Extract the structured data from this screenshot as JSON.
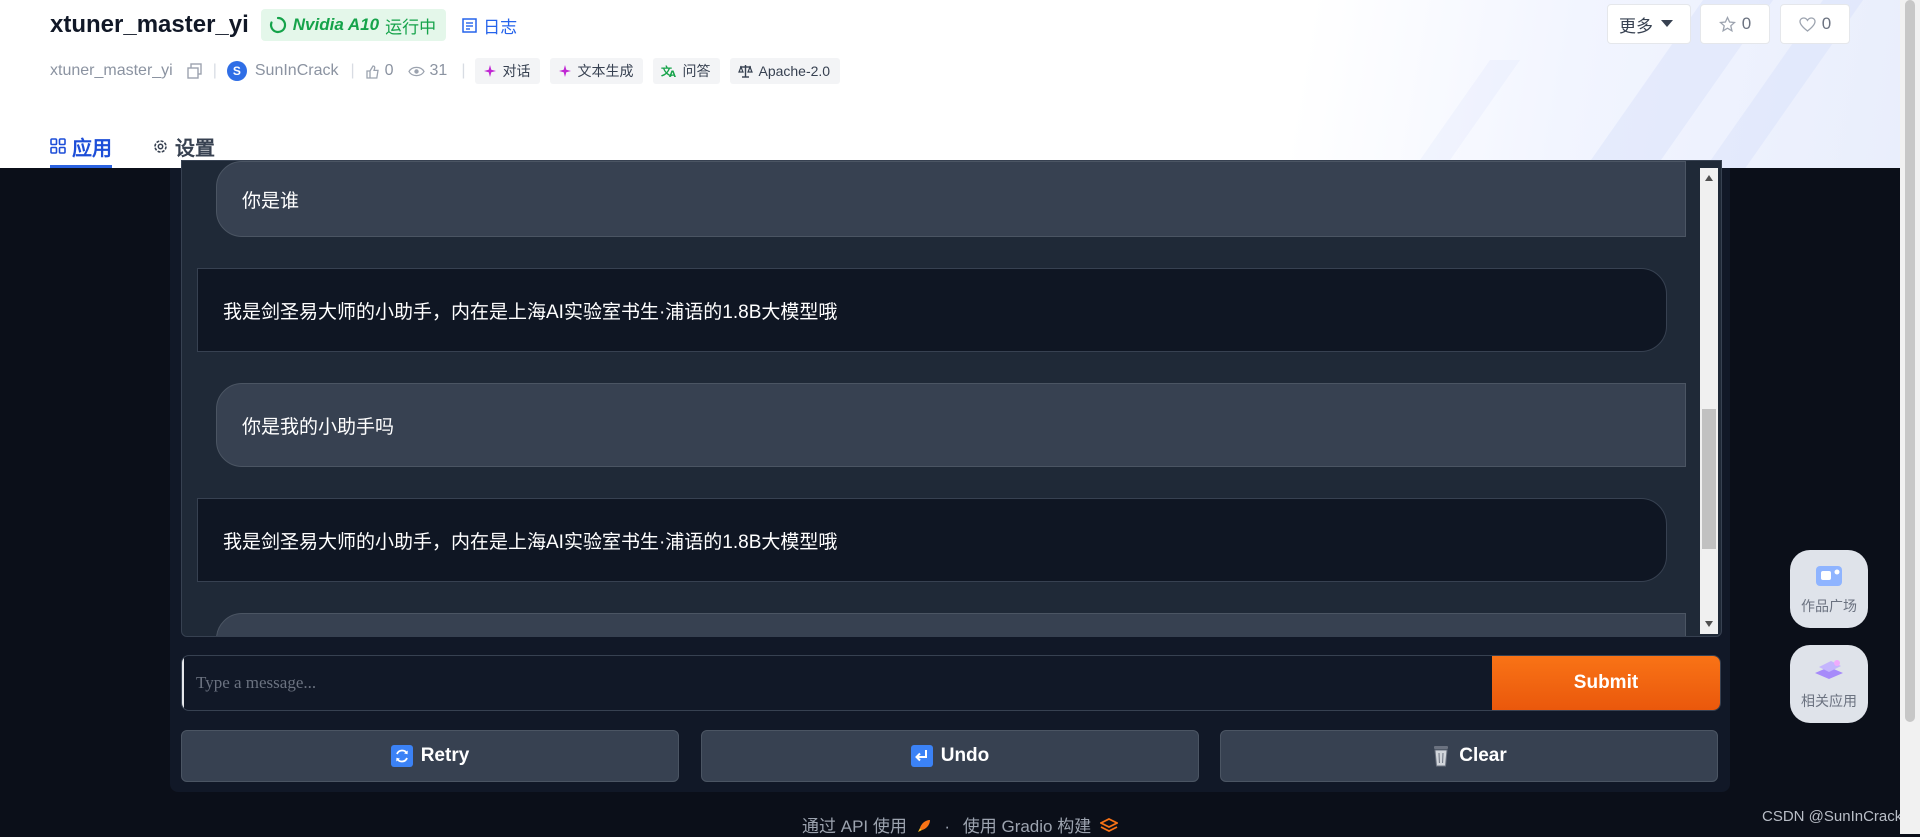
{
  "header": {
    "title": "xtuner_master_yi",
    "gpu": "Nvidia A10",
    "status": "运行中",
    "logs_label": "日志",
    "repo_name": "xtuner_master_yi",
    "author_initial": "S",
    "author": "SunInCrack",
    "likes": "0",
    "views": "31",
    "tags": [
      "对话",
      "文本生成",
      "问答",
      "Apache-2.0"
    ],
    "more_label": "更多",
    "star_count": "0",
    "heart_count": "0"
  },
  "tabs": [
    {
      "label": "应用",
      "active": true
    },
    {
      "label": "设置",
      "active": false
    }
  ],
  "chat": {
    "messages": [
      {
        "role": "user",
        "text": "你是谁"
      },
      {
        "role": "bot",
        "text": "我是剑圣易大师的小助手，内在是上海AI实验室书生·浦语的1.8B大模型哦"
      },
      {
        "role": "user",
        "text": "你是我的小助手吗"
      },
      {
        "role": "bot",
        "text": "我是剑圣易大师的小助手，内在是上海AI实验室书生·浦语的1.8B大模型哦"
      },
      {
        "role": "user",
        "text": ""
      }
    ],
    "scroll_position": 0.42
  },
  "input": {
    "placeholder": "Type a message...",
    "submit_label": "Submit"
  },
  "actions": {
    "retry_label": "Retry",
    "undo_label": "Undo",
    "clear_label": "Clear"
  },
  "footer": {
    "api_text": "通过 API 使用",
    "separator": "·",
    "built_text": "使用 Gradio 构建"
  },
  "side": {
    "gallery_label": "作品广场",
    "related_label": "相关应用"
  },
  "watermark": "CSDN @SunInCrack",
  "colors": {
    "accent_blue": "#1d4ed8",
    "status_green": "#15a34a",
    "submit_orange": "#f97316",
    "app_bg": "#0b0f19"
  }
}
